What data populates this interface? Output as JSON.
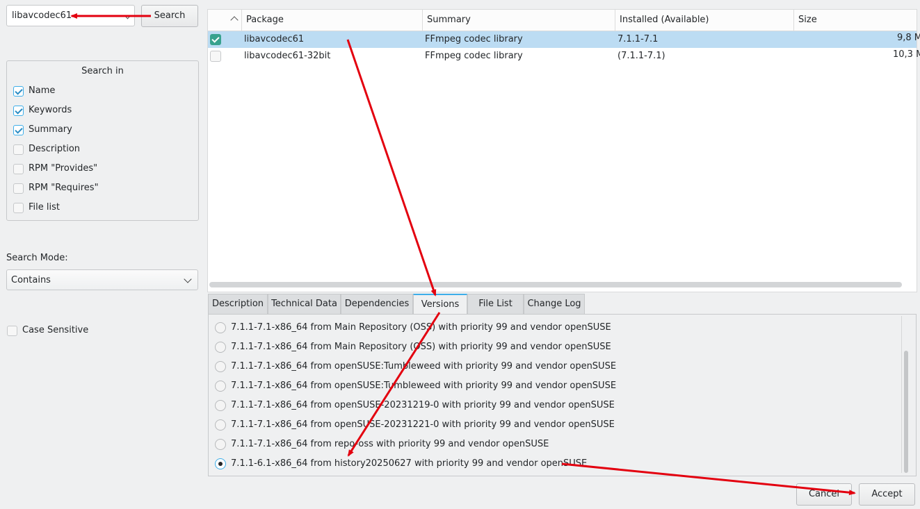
{
  "search": {
    "value": "libavcodec61",
    "button_label": "Search"
  },
  "search_in": {
    "title": "Search in",
    "options": [
      {
        "label": "Name",
        "checked": true
      },
      {
        "label": "Keywords",
        "checked": true
      },
      {
        "label": "Summary",
        "checked": true
      },
      {
        "label": "Description",
        "checked": false
      },
      {
        "label": "RPM \"Provides\"",
        "checked": false
      },
      {
        "label": "RPM \"Requires\"",
        "checked": false
      },
      {
        "label": "File list",
        "checked": false
      }
    ]
  },
  "search_mode": {
    "label": "Search Mode:",
    "value": "Contains"
  },
  "case_sensitive": {
    "label": "Case Sensitive",
    "checked": false
  },
  "table": {
    "columns": [
      "Package",
      "Summary",
      "Installed (Available)",
      "Size"
    ],
    "rows": [
      {
        "checked": true,
        "package": "libavcodec61",
        "summary": "FFmpeg codec library",
        "installed": "7.1.1-7.1",
        "size": "9,8 M",
        "selected": true
      },
      {
        "checked": false,
        "package": "libavcodec61-32bit",
        "summary": "FFmpeg codec library",
        "installed": "(7.1.1-7.1)",
        "size": "10,3 M",
        "selected": false
      }
    ]
  },
  "tabs": [
    "Description",
    "Technical Data",
    "Dependencies",
    "Versions",
    "File List",
    "Change Log"
  ],
  "active_tab": "Versions",
  "versions": [
    {
      "label": "7.1.1-7.1-x86_64 from Main Repository (OSS) with priority 99 and vendor openSUSE",
      "selected": false
    },
    {
      "label": "7.1.1-7.1-x86_64 from Main Repository (OSS) with priority 99 and vendor openSUSE",
      "selected": false
    },
    {
      "label": "7.1.1-7.1-x86_64 from openSUSE:Tumbleweed with priority 99 and vendor openSUSE",
      "selected": false
    },
    {
      "label": "7.1.1-7.1-x86_64 from openSUSE:Tumbleweed with priority 99 and vendor openSUSE",
      "selected": false
    },
    {
      "label": "7.1.1-7.1-x86_64 from openSUSE-20231219-0 with priority 99 and vendor openSUSE",
      "selected": false
    },
    {
      "label": "7.1.1-7.1-x86_64 from openSUSE-20231221-0 with priority 99 and vendor openSUSE",
      "selected": false
    },
    {
      "label": "7.1.1-7.1-x86_64 from repo-oss with priority 99 and vendor openSUSE",
      "selected": false
    },
    {
      "label": "7.1.1-6.1-x86_64 from history20250627 with priority 99 and vendor openSUSE",
      "selected": true
    }
  ],
  "buttons": {
    "cancel": "Cancel",
    "accept": "Accept"
  },
  "colors": {
    "accent": "#3daee9",
    "selection": "#bcdcf3",
    "annotation": "#e3000f"
  }
}
